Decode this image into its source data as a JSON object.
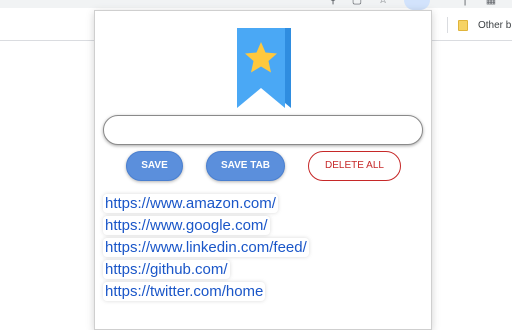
{
  "browser": {
    "bookmarks_bar": {
      "other_bookmarks_label": "Other b"
    },
    "toolbar_icons": [
      "search-icon",
      "share-icon",
      "star-icon",
      "extension-icon",
      "window-icon"
    ]
  },
  "popup": {
    "url_input": {
      "value": "",
      "placeholder": ""
    },
    "buttons": {
      "save_label": "SAVE",
      "save_tab_label": "SAVE TAB",
      "delete_all_label": "DELETE ALL"
    },
    "links": [
      "https://www.amazon.com/",
      "https://www.google.com/",
      "https://www.linkedin.com/feed/",
      "https://github.com/",
      "https://twitter.com/home"
    ]
  },
  "colors": {
    "accent_blue": "#5b8fdc",
    "delete_red": "#c62828",
    "link_blue": "#1a56c8",
    "logo_blue": "#4aa8f5",
    "star_yellow": "#ffc83d"
  }
}
